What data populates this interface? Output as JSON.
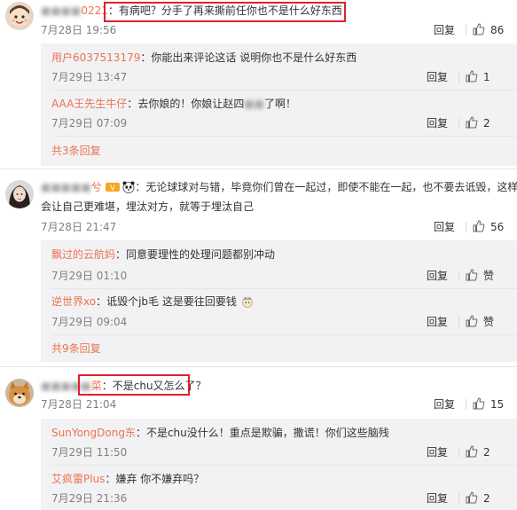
{
  "colors": {
    "accent": "#eb7350",
    "highlight_box": "#e0202a",
    "sub_bg": "#f2f2f5"
  },
  "labels": {
    "reply": "回复",
    "like_icon": "thumbs-up-icon"
  },
  "comments": [
    {
      "user": "0221",
      "sep": "：",
      "text": "有病吧？分手了再来撕前任你也不是什么好东西！",
      "date": "7月28日 19:56",
      "likes": "86",
      "replies": [
        {
          "user": "用户6037513179",
          "sep": "：",
          "text": "你能出来评论这话 说明你也不是什么好东西",
          "date": "7月29日 13:47",
          "likes": "1"
        },
        {
          "user": "AAA王先生牛仔",
          "sep": "：",
          "text_a": "去你娘的！你娘让赵四",
          "text_b": "了啊！",
          "date": "7月29日 07:09",
          "likes": "2"
        }
      ],
      "more": "共3条回复"
    },
    {
      "user": "兮",
      "sep": "：",
      "text_line1": "无论球球对与错，毕竟你们曾在一起过，即使不能在一起，也不要去诋毁，这样只",
      "text_line2": "会让自己更难堪，埋汰对方，就等于埋汰自己",
      "date": "7月28日 21:47",
      "likes": "56",
      "replies": [
        {
          "user": "飘过的云航妈",
          "sep": "：",
          "text": "同意要理性的处理问题都别冲动",
          "date": "7月29日 01:10",
          "likes": "赞"
        },
        {
          "user": "逆世界xo",
          "sep": "：",
          "text": "诋毁个jb毛 这是要往回要钱",
          "date": "7月29日 09:04",
          "likes": "赞"
        }
      ],
      "more": "共9条回复"
    },
    {
      "user": "菜",
      "sep": "：",
      "text": "不是chu又怎么了？",
      "date": "7月28日 21:04",
      "likes": "15",
      "replies": [
        {
          "user": "SunYongDong东",
          "sep": "：",
          "text": "不是chu没什么！重点是欺骗，撒谎！你们这些脑残",
          "date": "7月29日 11:50",
          "likes": "2"
        },
        {
          "user": "艾疯雷Plus",
          "sep": "：",
          "text": "嫌弃 你不嫌弃吗？",
          "date": "7月29日 21:36",
          "likes": "2"
        }
      ]
    }
  ]
}
